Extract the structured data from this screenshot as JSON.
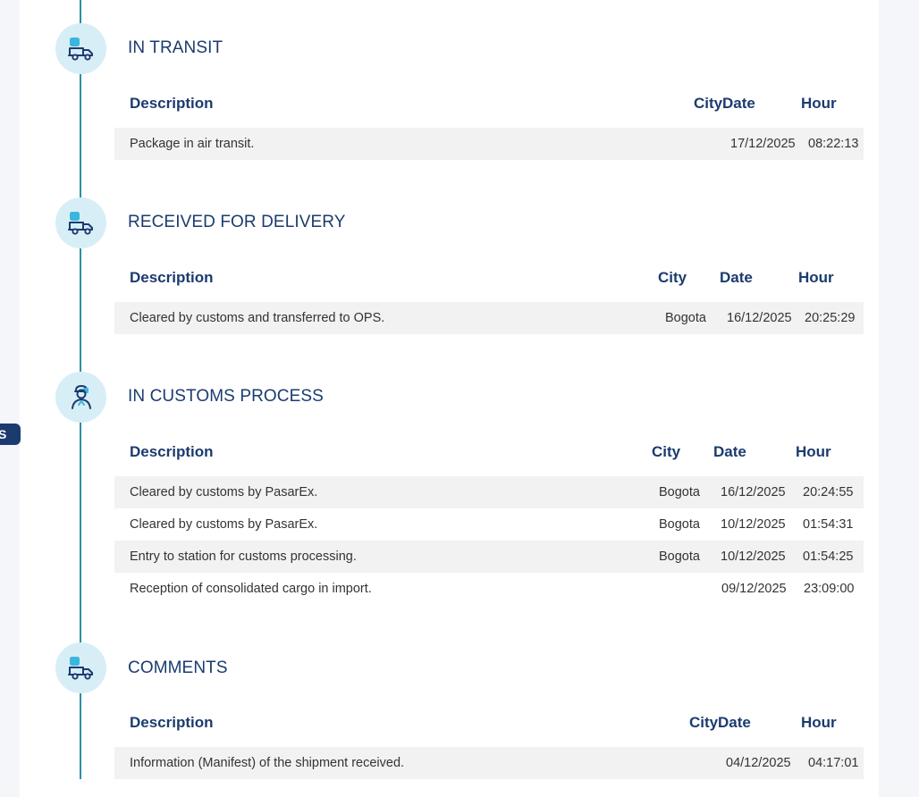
{
  "side_tab": {
    "label": "S"
  },
  "colors": {
    "accent": "#1b3b6f",
    "timeline": "#2a8fa8",
    "icon_bg": "#d8eef7",
    "row_shade": "#f2f2f2"
  },
  "sections": [
    {
      "title": "IN TRANSIT",
      "icon": "delivery-truck-icon",
      "headers": {
        "description": "Description",
        "city": "City",
        "date": "Date",
        "hour": "Hour"
      },
      "rows": [
        {
          "description": "Package in air transit.",
          "city": "",
          "date": "17/12/2025",
          "hour": "08:22:13"
        }
      ]
    },
    {
      "title": "RECEIVED FOR DELIVERY",
      "icon": "delivery-truck-icon",
      "headers": {
        "description": "Description",
        "city": "City",
        "date": "Date",
        "hour": "Hour"
      },
      "rows": [
        {
          "description": "Cleared by customs and transferred to OPS.",
          "city": "Bogota",
          "date": "16/12/2025",
          "hour": "20:25:29"
        }
      ]
    },
    {
      "title": "IN CUSTOMS PROCESS",
      "icon": "customs-officer-icon",
      "headers": {
        "description": "Description",
        "city": "City",
        "date": "Date",
        "hour": "Hour"
      },
      "rows": [
        {
          "description": "Cleared by customs by PasarEx.",
          "city": "Bogota",
          "date": "16/12/2025",
          "hour": "20:24:55"
        },
        {
          "description": "Cleared by customs by PasarEx.",
          "city": "Bogota",
          "date": "10/12/2025",
          "hour": "01:54:31"
        },
        {
          "description": "Entry to station for customs processing.",
          "city": "Bogota",
          "date": "10/12/2025",
          "hour": "01:54:25"
        },
        {
          "description": "Reception of consolidated cargo in import.",
          "city": "",
          "date": "09/12/2025",
          "hour": "23:09:00"
        }
      ]
    },
    {
      "title": "COMMENTS",
      "icon": "delivery-truck-icon",
      "headers": {
        "description": "Description",
        "city": "City",
        "date": "Date",
        "hour": "Hour"
      },
      "rows": [
        {
          "description": "Information (Manifest) of the shipment received.",
          "city": "",
          "date": "04/12/2025",
          "hour": "04:17:01"
        }
      ]
    }
  ]
}
